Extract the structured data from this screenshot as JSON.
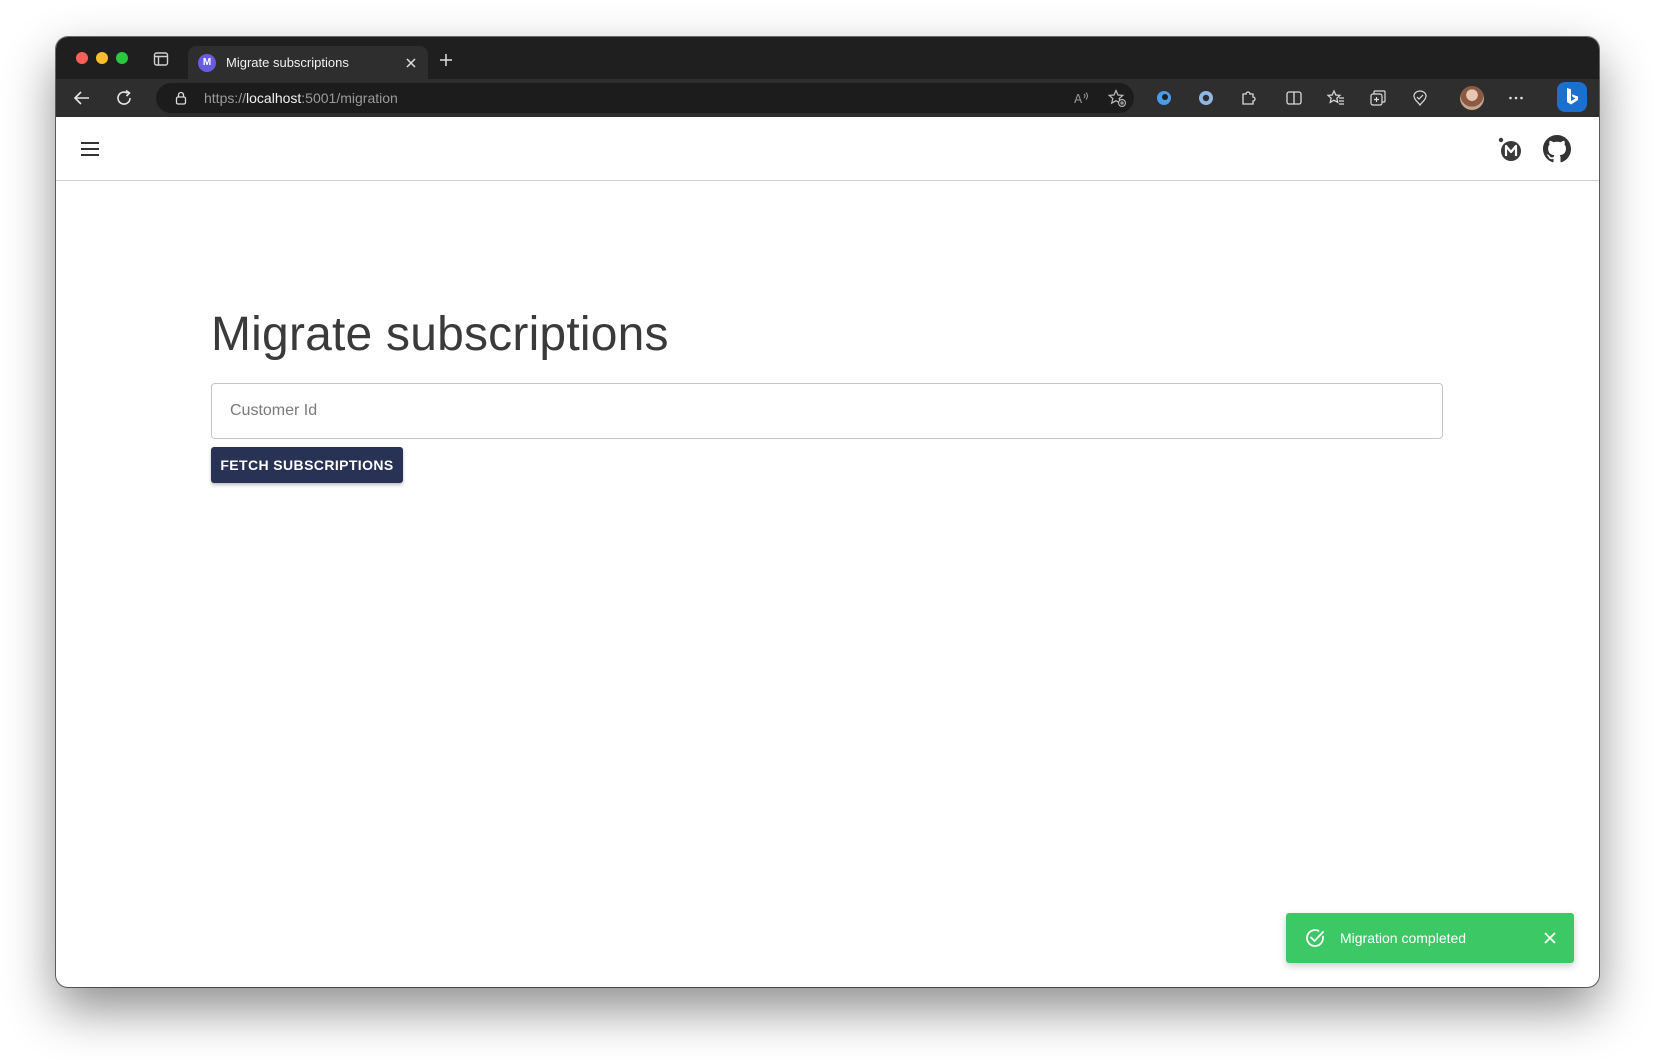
{
  "browser": {
    "tab": {
      "favicon_letter": "M",
      "title": "Migrate subscriptions"
    },
    "address_bar": {
      "scheme": "https://",
      "host": "localhost",
      "path": ":5001/migration"
    },
    "toolbar_icons": [
      "back-icon",
      "refresh-icon",
      "read-aloud-icon",
      "add-favorite-icon",
      "extension-icon",
      "extension-icon",
      "extensions-icon",
      "split-screen-icon",
      "favorites-icon",
      "collections-icon",
      "browser-essentials-icon",
      "profile-avatar",
      "more-icon",
      "bing-copilot-icon"
    ]
  },
  "appbar": {
    "icons": [
      "menu-icon",
      "app-logo-icon",
      "github-icon"
    ]
  },
  "main": {
    "title": "Migrate subscriptions",
    "customer_id_placeholder": "Customer Id",
    "customer_id_value": "",
    "fetch_button_label": "FETCH SUBSCRIPTIONS"
  },
  "snackbar": {
    "message": "Migration completed",
    "color": "#3cc864"
  },
  "colors": {
    "primary_button": "#283254",
    "success": "#3cc864",
    "browser_chrome": "#1f1f1f"
  }
}
